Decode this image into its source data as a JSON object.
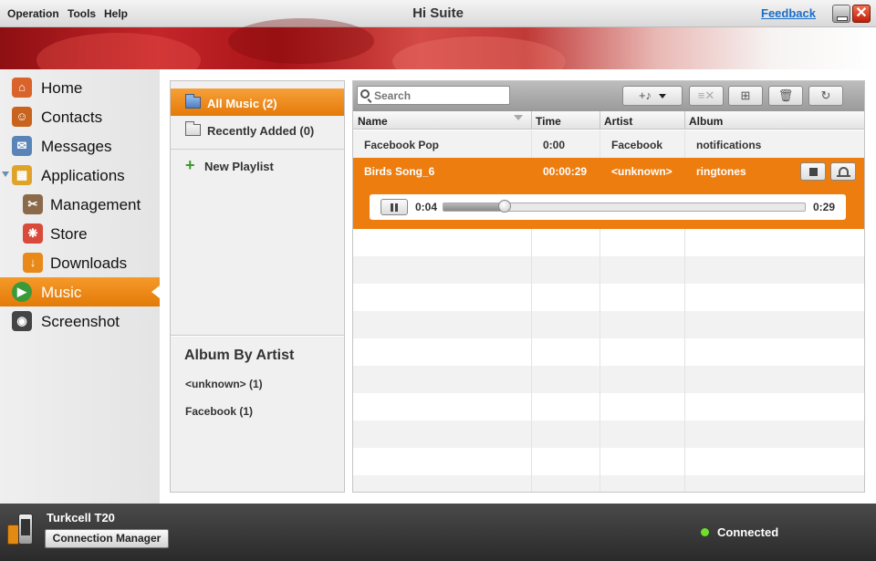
{
  "app": {
    "title": "Hi Suite"
  },
  "menu": {
    "operation": "Operation",
    "tools": "Tools",
    "help": "Help",
    "feedback": "Feedback"
  },
  "window": {
    "close_glyph": "✕"
  },
  "sidebar": {
    "items": [
      {
        "label": "Home",
        "icon": "home-icon",
        "color": "#d9632a"
      },
      {
        "label": "Contacts",
        "icon": "contacts-icon",
        "color": "#c8641e"
      },
      {
        "label": "Messages",
        "icon": "messages-icon",
        "color": "#5a84b8"
      },
      {
        "label": "Applications",
        "icon": "applications-icon",
        "color": "#e0a32a"
      },
      {
        "label": "Management",
        "icon": "management-icon",
        "color": "#8a6a4a"
      },
      {
        "label": "Store",
        "icon": "store-icon",
        "color": "#d94a3a"
      },
      {
        "label": "Downloads",
        "icon": "downloads-icon",
        "color": "#e8891a"
      },
      {
        "label": "Music",
        "icon": "music-icon",
        "color": "#3a9a3a"
      },
      {
        "label": "Screenshot",
        "icon": "screenshot-icon",
        "color": "#444444"
      }
    ],
    "active": "Music"
  },
  "library": {
    "all_music": "All Music (2)",
    "recently_added": "Recently Added (0)",
    "new_playlist": "New Playlist",
    "album_by_artist_title": "Album By Artist",
    "albums": [
      "<unknown> (1)",
      "Facebook (1)"
    ]
  },
  "toolbar": {
    "search_placeholder": "Search",
    "buttons": [
      "add-music",
      "remove-from-list",
      "export",
      "delete",
      "refresh"
    ]
  },
  "table": {
    "columns": [
      "Name",
      "Time",
      "Artist",
      "Album"
    ],
    "rows": [
      {
        "name": "Facebook Pop",
        "time": "0:00",
        "artist": "Facebook",
        "album": "notifications"
      },
      {
        "name": "Birds Song_6",
        "time": "00:00:29",
        "artist": "<unknown>",
        "album": "ringtones"
      }
    ],
    "selected_index": 1
  },
  "player": {
    "elapsed": "0:04",
    "duration": "0:29",
    "progress": 0.17
  },
  "status": {
    "device": "Turkcell T20",
    "connection_manager": "Connection Manager",
    "state": "Connected",
    "state_color": "#6ee02a"
  },
  "colors": {
    "accent": "#ed7d0f",
    "banner": "#c3262a"
  }
}
